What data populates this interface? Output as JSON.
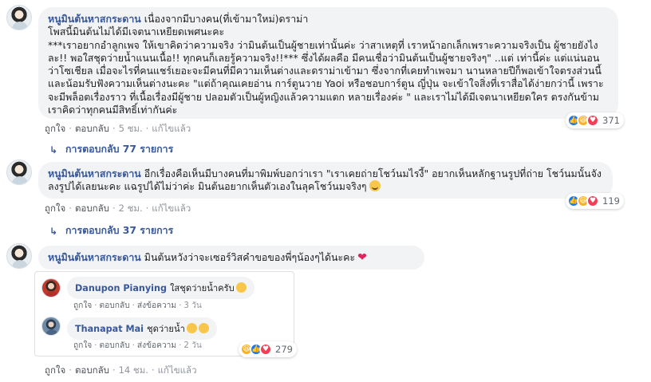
{
  "comments": [
    {
      "author": "หนูมินต้นหาสกระดาน",
      "text_lines": [
        "เนื่องจากมีบางคน(ที่เข้ามาใหม่)ดราม่า",
        "โพสนี้มินต้นไม่ได้มีเจตนาเหยียดเพศนะคะ",
        "***เราอยากอำลูกเพจ ให้เขาคิดว่าความจริง ว่ามินต้นเป็นผู้ชายเท่านั้นค่ะ ว่าสาเหตุที่ เราหน้าอกเล็กเพราะความจริงเป็น ผู้ชายยังไงละ!! พอใสชุดว่ายน้ำแนนเนื้อ!! ทุกคนก็เลยรู้ความจริง!!*** ซึ่งได้ผลคือ มีคนเชื่อว่ามินต้นเป็นผู้ชายจริงๆ\" ..แต่ เท่านี้ค่ะ แต่แน่นอนว่าโซเชียล เมื่อจะไรที่คนแชร์เยอะจะมีคนที่มีความเห็นต่างและดราม่าเข้ามา ซึ่งจากที่เคยทำเพจมา นานหลายปีก็พอเข้าใจตรงส่วนนี้ และน้อมรับฟังความเห็นต่างนะคะ \"แต่ถ้าคุณเคยอ่าน การ์ตูนวาย Yaoi หรือชอบการ์ตูน ญี่ปุ่น จะเข้าใจสิ่งที่เราสื่อได้ง่ายกว่านี้ เพราะจะมีพล็อตเรื่องราว ที่เนื้อเรื่องมีผู้ชาย ปลอมตัวเป็นผู้หญิงแล้วความแตก หลายเรื่องค่ะ \" และเราไม่ได้มีเจตนาเหยียดใคร ตรงกันข้าม เราคิดว่าทุกคนมีสิทธิ์เท่ากันค่ะ"
      ],
      "actions": {
        "like": "ถูกใจ",
        "reply": "ตอบกลับ",
        "time": "5 ชม.",
        "edited": "แก้ไขแล้ว"
      },
      "reaction_count": "371",
      "reactions": [
        "like",
        "haha",
        "love"
      ],
      "replies_label": "การตอบกลับ 77 รายการ"
    },
    {
      "author": "หนูมินต้นหาสกระดาน",
      "text": "อีกเรื่องคือเห็นมีบางคนที่มาพิมพ์บอกว่าเรา \"เราเคยถ่ายโชว์นมไรงี้\" อยากเห็นหลักฐานรูปที่ถ่าย โชว์นมนั้นจัง ลงรูปได้เลยนะคะ แฉรูปได้ไม่ว่าค่ะ มินต้นอยากเห็นตัวเองในลุคโชว์นมจริงๆ",
      "actions": {
        "like": "ถูกใจ",
        "reply": "ตอบกลับ",
        "time": "2 ชม.",
        "edited": "แก้ไขแล้ว"
      },
      "reaction_count": "119",
      "reactions": [
        "like",
        "haha",
        "love"
      ],
      "replies_label": "การตอบกลับ 37 รายการ"
    },
    {
      "author": "หนูมินต้นหาสกระดาน",
      "text": "มินต้นหวังว่าจะเซอร์วิสคำขอของพี่ๆน้องๆได้นะคะ",
      "actions": {
        "like": "ถูกใจ",
        "reply": "ตอบกลับ",
        "time": "14 ชม.",
        "edited": "แก้ไขแล้ว"
      },
      "reaction_count": "279",
      "reactions": [
        "haha",
        "like",
        "love"
      ],
      "replies": [
        {
          "author": "Danupon Pianying",
          "text": "ใสชุดว่ายน้ำครับ",
          "like": "ถูกใจ",
          "reply": "ตอบกลับ",
          "message": "ส่งข้อความ",
          "time": "3 วัน"
        },
        {
          "author": "Thanapat Mai",
          "text": "ชุดว่ายน้ำ",
          "like": "ถูกใจ",
          "reply": "ตอบกลับ",
          "message": "ส่งข้อความ",
          "time": "2 วัน"
        }
      ]
    }
  ],
  "colors": {
    "name": "#385898",
    "bubble": "#f2f3f5",
    "like": "#1877f2",
    "love": "#f33e58",
    "haha": "#f7b125"
  }
}
